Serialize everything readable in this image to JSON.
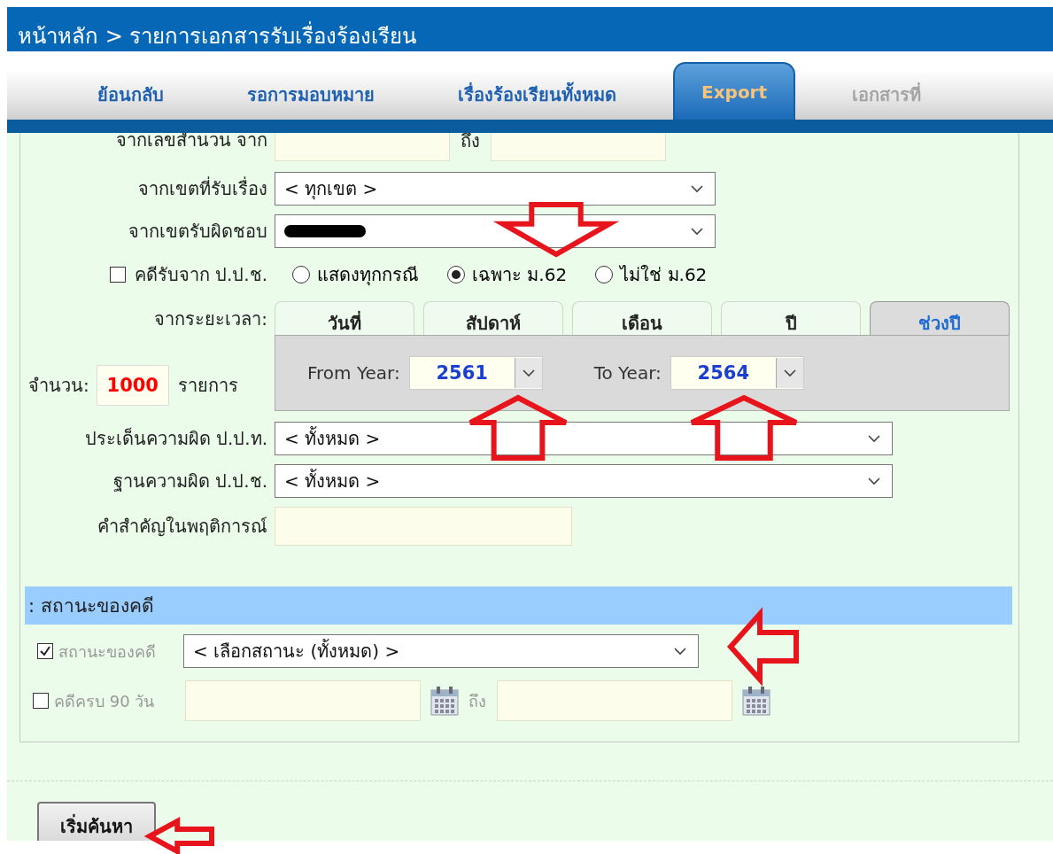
{
  "breadcrumb": "หน้าหลัก > รายการเอกสารรับเรื่องร้องเรียน",
  "tabs": [
    {
      "label": "ย้อนกลับ",
      "selected": false,
      "disabled": false
    },
    {
      "label": "รอการมอบหมาย",
      "selected": false,
      "disabled": false
    },
    {
      "label": "เรื่องร้องเรียนทั้งหมด",
      "selected": false,
      "disabled": false
    },
    {
      "label": "Export",
      "selected": true,
      "disabled": false
    },
    {
      "label": "เอกสารที่",
      "selected": false,
      "disabled": true
    }
  ],
  "form": {
    "case_number": {
      "label": "จากเลขสำนวน จาก",
      "to_label": "ถึง"
    },
    "receiving_area": {
      "label": "จากเขตที่รับเรื่อง",
      "value": "< ทุกเขต >"
    },
    "responsible_area": {
      "label": "จากเขตรับผิดชอบ",
      "redacted": true
    },
    "nacc_case": {
      "label": "คดีรับจาก ป.ป.ช.",
      "checked": false
    },
    "section_filter": [
      {
        "label": "แสดงทุกกรณี",
        "selected": false
      },
      {
        "label": "เฉพาะ ม.62",
        "selected": true
      },
      {
        "label": "ไม่ใช่ ม.62",
        "selected": false
      }
    ],
    "period": {
      "label": "จากระยะเวลา:",
      "tabs": [
        {
          "label": "วันที่",
          "selected": false
        },
        {
          "label": "สัปดาห์",
          "selected": false
        },
        {
          "label": "เดือน",
          "selected": false
        },
        {
          "label": "ปี",
          "selected": false
        },
        {
          "label": "ช่วงปี",
          "selected": true
        }
      ],
      "from_label": "From Year:",
      "from_value": "2561",
      "to_label": "To Year:",
      "to_value": "2564"
    },
    "count": {
      "label": "จำนวน:",
      "value": "1000",
      "unit": "รายการ"
    },
    "pacc_issue": {
      "label": "ประเด็นความผิด ป.ป.ท.",
      "value": "< ทั้งหมด >"
    },
    "nacc_basis": {
      "label": "ฐานความผิด ป.ป.ช.",
      "value": "< ทั้งหมด >"
    },
    "keyword": {
      "label": "คำสำคัญในพฤติการณ์"
    }
  },
  "status_section": {
    "title": ": สถานะของคดี",
    "status": {
      "label": "สถานะของคดี",
      "checked": true,
      "value": "< เลือกสถานะ (ทั้งหมด) >"
    },
    "due90": {
      "label": "คดีครบ 90 วัน",
      "checked": false,
      "to_label": "ถึง"
    }
  },
  "search_button": "เริ่มค้นหา"
}
